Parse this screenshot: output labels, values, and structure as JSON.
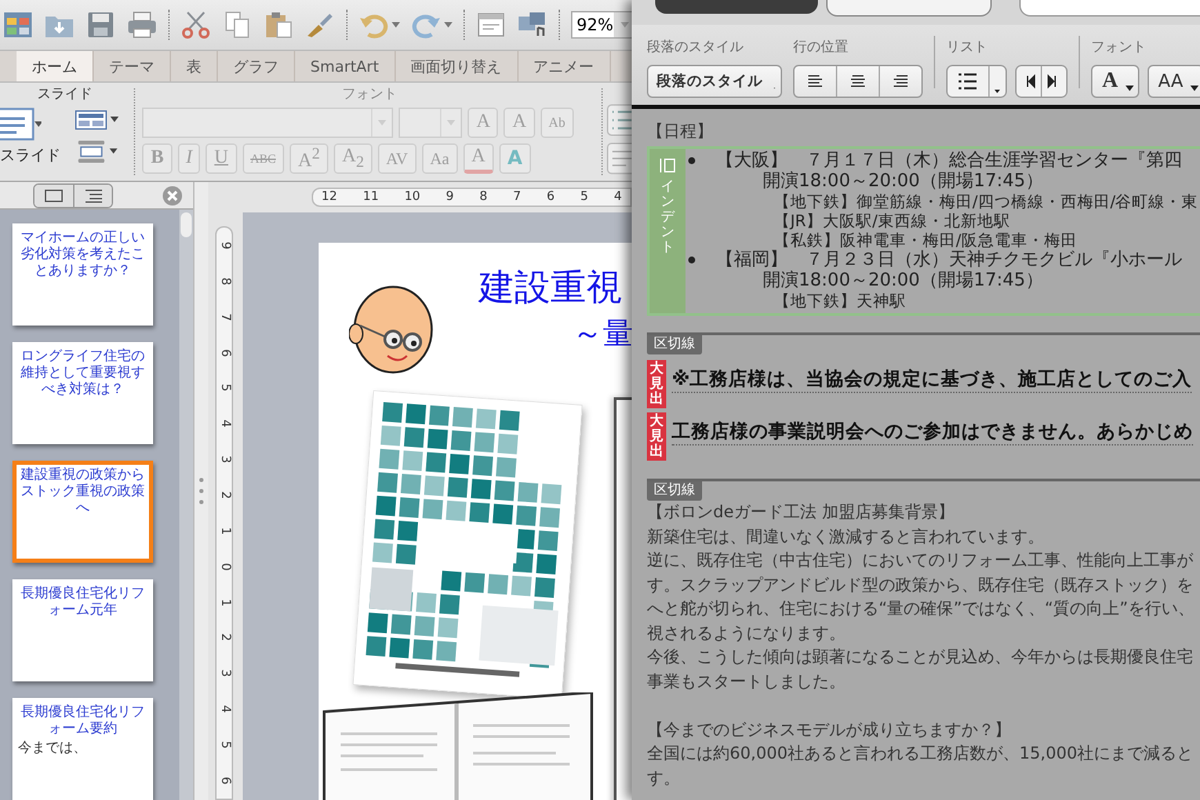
{
  "app": {
    "zoom": "92%",
    "tabs": [
      {
        "label": "ホーム",
        "selected": true
      },
      {
        "label": "テーマ",
        "selected": false
      },
      {
        "label": "表",
        "selected": false
      },
      {
        "label": "グラフ",
        "selected": false
      },
      {
        "label": "SmartArt",
        "selected": false
      },
      {
        "label": "画面切り替え",
        "selected": false
      },
      {
        "label": "アニメー",
        "selected": false
      }
    ],
    "ribbon": {
      "slide_group": "スライド",
      "new_slide": "スライド",
      "font_group": "フォント",
      "font_disabled": true,
      "font_row1": [
        {
          "kind": "grow",
          "label": "A"
        },
        {
          "kind": "shrink",
          "label": "A"
        },
        {
          "kind": "clear",
          "label": "Ab"
        }
      ],
      "font_row2": [
        {
          "kind": "bold",
          "label": "B"
        },
        {
          "kind": "italic",
          "label": "I"
        },
        {
          "kind": "underline",
          "label": "U"
        },
        {
          "kind": "strike",
          "label": "ABC"
        },
        {
          "kind": "sup",
          "label": "A$^{2}$"
        },
        {
          "kind": "sub",
          "label": "A$_{2}$"
        },
        {
          "kind": "spacing",
          "label": "AV"
        },
        {
          "kind": "case",
          "label": "Aa"
        },
        {
          "kind": "color",
          "label": "A"
        },
        {
          "kind": "effect",
          "label": "A"
        }
      ]
    },
    "slides": [
      {
        "title": "マイホームの正しい劣化対策を考えたことありますか？",
        "selected": false
      },
      {
        "title": "ロングライフ住宅の維持として重要視すべき対策は？",
        "selected": false
      },
      {
        "title": "建設重視の政策からストック重視の政策へ",
        "selected": true
      },
      {
        "title": "長期優良住宅化リフォーム元年",
        "selected": false
      },
      {
        "title": "長期優良住宅化リフォーム要約",
        "lines": [
          "今までは、"
        ],
        "selected": false
      }
    ],
    "h_ruler": [
      "12",
      "11",
      "10",
      "9",
      "8",
      "7",
      "6",
      "5",
      "4"
    ],
    "v_ruler": [
      "9",
      "8",
      "7",
      "6",
      "5",
      "4",
      "3",
      "2",
      "1",
      "0",
      "1",
      "2",
      "3",
      "4",
      "5",
      "6"
    ],
    "slide": {
      "title_lines": [
        "建設重視",
        "～量"
      ]
    }
  },
  "editor": {
    "groups": [
      "段落のスタイル",
      "行の位置",
      "リスト",
      "フォント"
    ],
    "style_button": "段落のスタイル",
    "font_buttons": [
      "A",
      "AA"
    ],
    "heading": "【日程】",
    "indent_block": {
      "label": "インデント",
      "lines": [
        {
          "kind": "bullet",
          "text": "【大阪】　７月１７日（木）総合生涯学習センター『第四"
        },
        {
          "kind": "time",
          "text": "開演18:00～20:00（開場17:45）"
        },
        {
          "kind": "detail",
          "text": "【地下鉄】御堂筋線・梅田/四つ橋線・西梅田/谷町線・東"
        },
        {
          "kind": "detail",
          "text": "【JR】大阪駅/東西線・北新地駅"
        },
        {
          "kind": "detail",
          "text": "【私鉄】阪神電車・梅田/阪急電車・梅田"
        },
        {
          "kind": "bullet",
          "text": "【福岡】　７月２３日（水）天神チクモクビル『小ホール"
        },
        {
          "kind": "time",
          "text": "開演18:00～20:00（開場17:45）"
        },
        {
          "kind": "detail",
          "text": "【地下鉄】天神駅"
        }
      ]
    },
    "divider_label": "区切線",
    "headlines": [
      {
        "tag": "大見出",
        "text": "※工務店様は、当協会の規定に基づき、施工店としてのご入"
      },
      {
        "tag": "大見出",
        "text": "工務店様の事業説明会へのご参加はできません。あらかじめ"
      }
    ],
    "divider_label_2": "区切線",
    "paragraphs": [
      [
        "【ボロンdeガード工法 加盟店募集背景】",
        "新築住宅は、間違いなく激減すると言われています。",
        "逆に、既存住宅（中古住宅）においてのリフォーム工事、性能向上工事が",
        "す。スクラップアンドビルド型の政策から、既存住宅（既存ストック）を",
        "へと舵が切られ、住宅における“量の確保”ではなく、“質の向上”を行い、",
        "視されるようになります。",
        "今後、こうした傾向は顕著になることが見込め、今年からは長期優良住宅",
        "事業もスタートしました。"
      ],
      [
        "【今までのビジネスモデルが成り立ちますか？】",
        "全国には約60,000社あると言われる工務店数が、15,000社にまで減ると",
        "す。"
      ]
    ]
  }
}
